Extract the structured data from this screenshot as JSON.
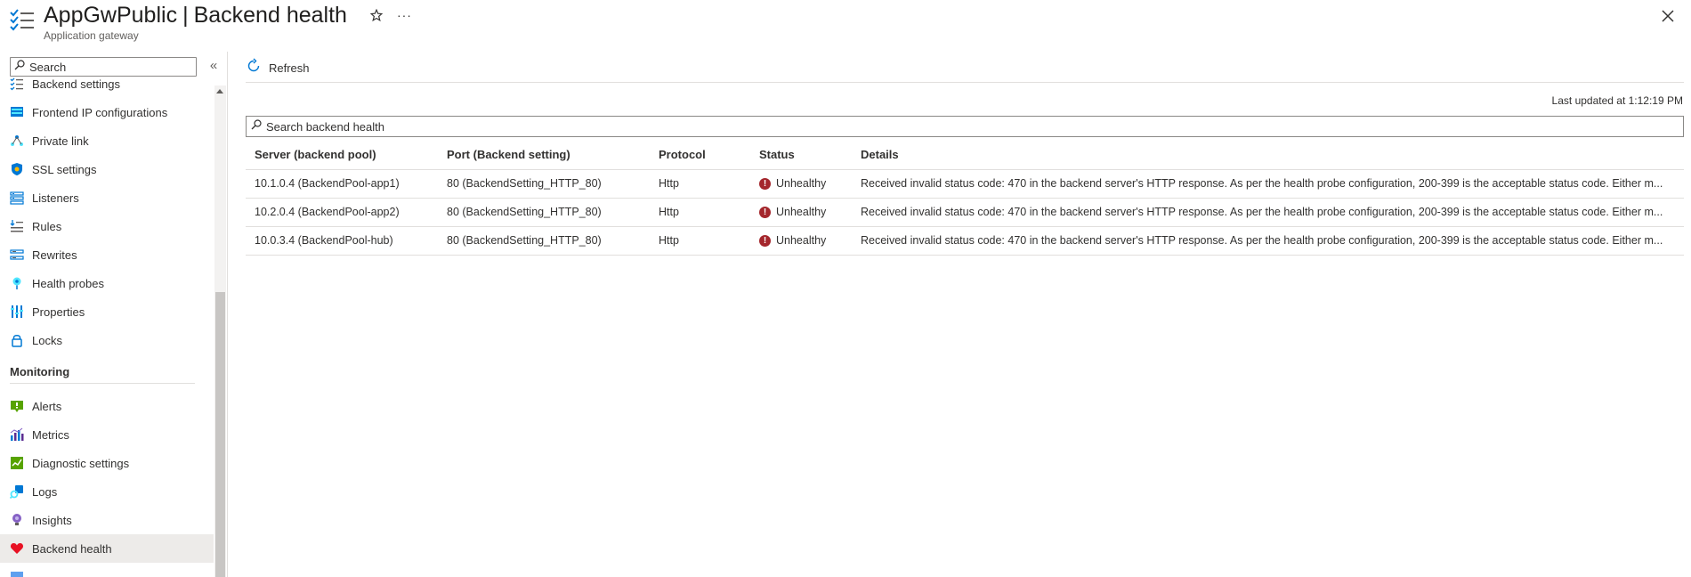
{
  "header": {
    "resource_name": "AppGwPublic",
    "separator": "|",
    "page_name": "Backend health",
    "subtitle": "Application gateway",
    "more_label": "···"
  },
  "sidebar": {
    "search_placeholder": "Search",
    "collapse_label": "«",
    "items_top": [
      {
        "label": "Backend settings",
        "icon": "backend-settings-icon"
      },
      {
        "label": "Frontend IP configurations",
        "icon": "frontend-ip-icon"
      },
      {
        "label": "Private link",
        "icon": "private-link-icon"
      },
      {
        "label": "SSL settings",
        "icon": "ssl-shield-icon"
      },
      {
        "label": "Listeners",
        "icon": "listeners-icon"
      },
      {
        "label": "Rules",
        "icon": "rules-icon"
      },
      {
        "label": "Rewrites",
        "icon": "rewrites-icon"
      },
      {
        "label": "Health probes",
        "icon": "health-probes-icon"
      },
      {
        "label": "Properties",
        "icon": "properties-icon"
      },
      {
        "label": "Locks",
        "icon": "lock-icon"
      }
    ],
    "section_monitoring": "Monitoring",
    "items_monitoring": [
      {
        "label": "Alerts",
        "icon": "alerts-icon"
      },
      {
        "label": "Metrics",
        "icon": "metrics-icon"
      },
      {
        "label": "Diagnostic settings",
        "icon": "diagnostic-settings-icon"
      },
      {
        "label": "Logs",
        "icon": "logs-icon"
      },
      {
        "label": "Insights",
        "icon": "insights-icon"
      },
      {
        "label": "Backend health",
        "icon": "heart-icon",
        "selected": true
      }
    ]
  },
  "toolbar": {
    "refresh_label": "Refresh"
  },
  "last_updated": "Last updated at 1:12:19 PM",
  "grid_search_placeholder": "Search backend health",
  "table": {
    "columns": [
      "Server (backend pool)",
      "Port (Backend setting)",
      "Protocol",
      "Status",
      "Details"
    ],
    "rows": [
      {
        "server": "10.1.0.4 (BackendPool-app1)",
        "port": "80 (BackendSetting_HTTP_80)",
        "protocol": "Http",
        "status": "Unhealthy",
        "details": "Received invalid status code: 470 in the backend server's HTTP response. As per the health probe configuration, 200-399 is the acceptable status code. Either m..."
      },
      {
        "server": "10.2.0.4 (BackendPool-app2)",
        "port": "80 (BackendSetting_HTTP_80)",
        "protocol": "Http",
        "status": "Unhealthy",
        "details": "Received invalid status code: 470 in the backend server's HTTP response. As per the health probe configuration, 200-399 is the acceptable status code. Either m..."
      },
      {
        "server": "10.0.3.4 (BackendPool-hub)",
        "port": "80 (BackendSetting_HTTP_80)",
        "protocol": "Http",
        "status": "Unhealthy",
        "details": "Received invalid status code: 470 in the backend server's HTTP response. As per the health probe configuration, 200-399 is the acceptable status code. Either m..."
      }
    ]
  },
  "colors": {
    "accent": "#0078d4",
    "error": "#a4262c",
    "selected_bg": "#edebe9"
  }
}
